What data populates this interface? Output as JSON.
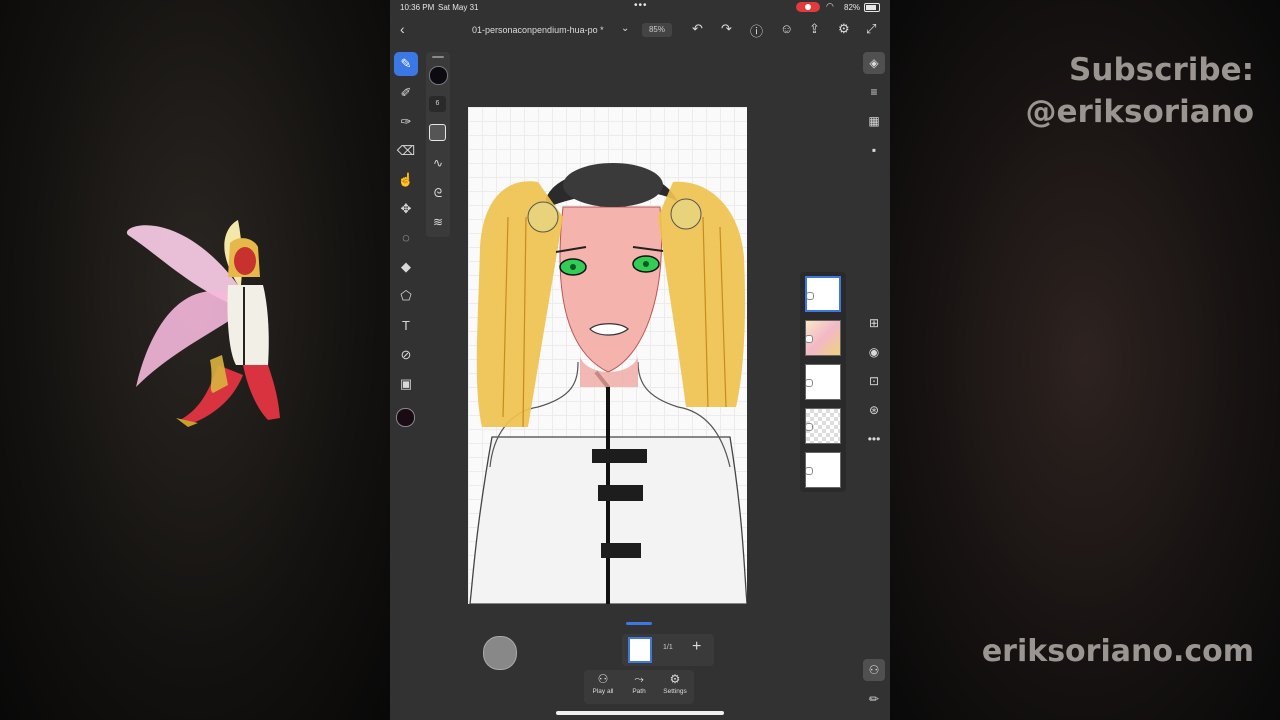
{
  "promo": {
    "subscribe_line": "Subscribe:",
    "handle_line": "@eriksoriano",
    "website": "eriksoriano.com"
  },
  "statusbar": {
    "time": "10:36 PM",
    "date": "Sat May 31",
    "battery": "82%",
    "dots": "•••"
  },
  "topbar": {
    "document_title": "01-personaconpendium-hua-po *",
    "zoom": "85%"
  },
  "toolbar": {
    "brush_size": "6",
    "color": "#0e0a12"
  },
  "animation": {
    "frame_count": "1/1"
  },
  "playbar": {
    "play_all": "Play all",
    "path": "Path",
    "settings": "Settings"
  },
  "icons": {
    "back": "chevron-left-icon",
    "undo": "undo-icon",
    "redo": "redo-icon",
    "help": "help-icon",
    "share": "share-icon",
    "settings": "gear-icon",
    "fullscreen": "expand-icon",
    "layers": "layers-icon"
  },
  "colors": {
    "accent": "#3c77e6",
    "panel": "#323232",
    "record": "#e03a3a"
  }
}
